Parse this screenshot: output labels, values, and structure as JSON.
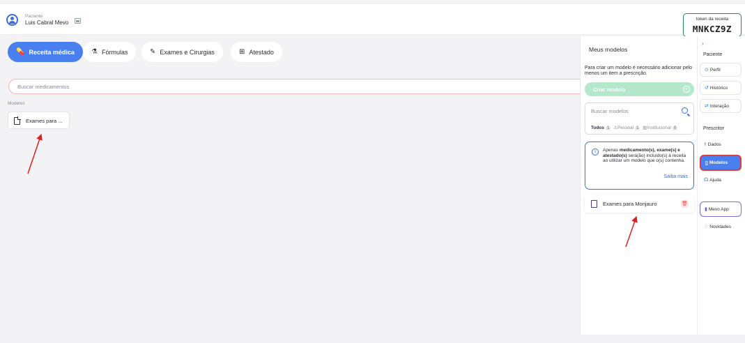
{
  "header": {
    "patient_caption": "Paciente",
    "patient_name": "Luis Cabral Mevo",
    "token_label": "token da receita",
    "token_value": "MNKCZ9Z"
  },
  "tabs": [
    {
      "label": "Receita médica",
      "icon": "pills-icon",
      "active": true
    },
    {
      "label": "Fórmulas",
      "icon": "flask-icon",
      "active": false
    },
    {
      "label": "Exames e Cirurgias",
      "icon": "scalpel-icon",
      "active": false
    },
    {
      "label": "Atestado",
      "icon": "document-plus-icon",
      "active": false
    }
  ],
  "main": {
    "search_placeholder": "Buscar medicamentos",
    "models_label": "Modelos",
    "model_card_label": "Exames para ..."
  },
  "panel": {
    "title": "Meus modelos",
    "info": "Para criar um modelo é necessário adicionar pelo menos um item a prescrição.",
    "create_label": "Criar modelo",
    "search_placeholder": "Buscar modelos",
    "filter_all": "Todos",
    "filter_all_count": "1",
    "filter_personal": "Pessoal",
    "filter_personal_count": "1",
    "filter_institutional": "Institucional",
    "filter_institutional_count": "0",
    "notice_pre": "Apenas ",
    "notice_bold": "medicamento(s), exame(s) e atestado(s)",
    "notice_post": " será(ão) incluído(s) à receita ao utilizar um modelo que o(s) contenha.",
    "notice_link": "Saiba mais",
    "model_item": "Exames para Monjauro"
  },
  "sidebar": {
    "section_patient": "Paciente",
    "perfil": "Perfil",
    "historico": "Histórico",
    "interacao": "Interação",
    "section_prescriber": "Prescritor",
    "dados": "Dados",
    "modelos": "Modelos",
    "ajuda": "Ajuda",
    "mevo_app": "Mevo App",
    "novidades": "Novidades"
  },
  "colors": {
    "accent": "#4a7ff0",
    "create_button": "#b5e7cc",
    "highlight_border": "#e03a3a",
    "arrow": "#e02020"
  }
}
